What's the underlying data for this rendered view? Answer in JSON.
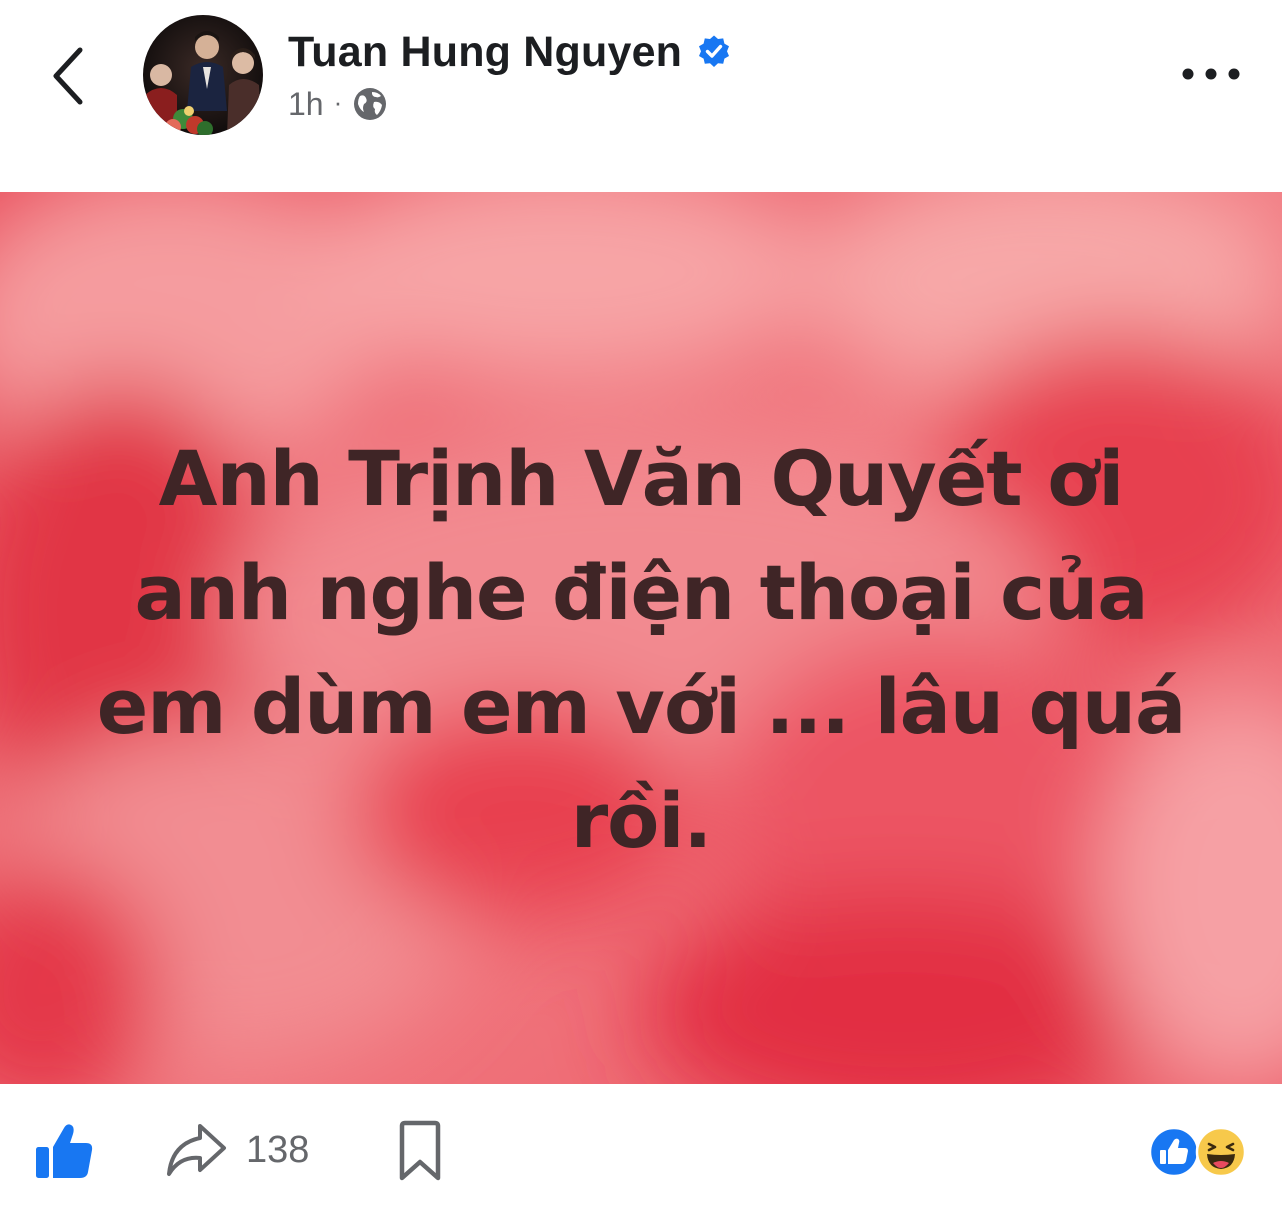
{
  "header": {
    "author_name": "Tuan Hung Nguyen",
    "timestamp": "1h",
    "separator": "·",
    "audience_icon": "globe-icon",
    "verified_icon": "verified-badge-icon",
    "back_icon": "chevron-left-icon",
    "more_icon": "more-horizontal-icon"
  },
  "post": {
    "lines": [
      "Anh Trịnh Văn Quyết ơi",
      "anh nghe điện thoại của",
      "em dùm em với ... lâu quá",
      "rồi."
    ],
    "text_color": "#3f2526",
    "background_color": "#ee6a72"
  },
  "footer": {
    "like_icon": "like-thumb-icon",
    "share_icon": "share-arrow-icon",
    "share_count": "138",
    "save_icon": "bookmark-icon",
    "reactions": [
      "like",
      "haha"
    ]
  },
  "colors": {
    "facebook_blue": "#1877f2",
    "secondary_text": "#65676b",
    "haha_yellow": "#f7c94b"
  }
}
